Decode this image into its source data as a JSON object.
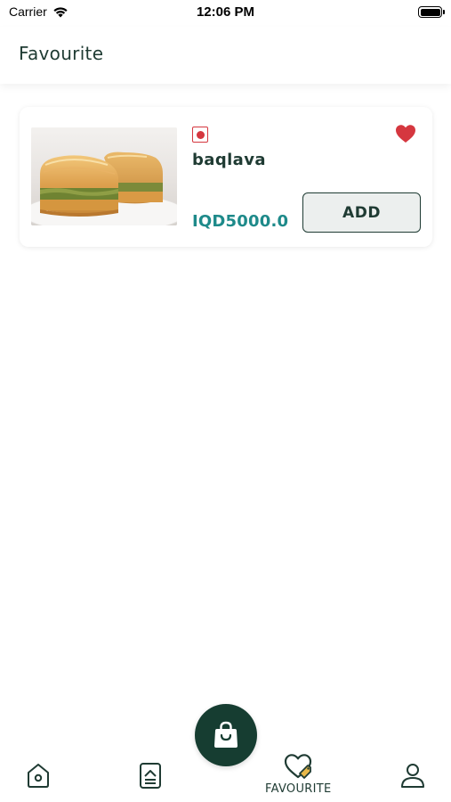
{
  "status_bar": {
    "carrier": "Carrier",
    "time": "12:06 PM"
  },
  "header": {
    "title": "Favourite"
  },
  "favourites": [
    {
      "name": "baqlava",
      "price": "IQD5000.0",
      "add_label": "ADD",
      "favourited": true
    }
  ],
  "bottom_nav": {
    "active": "favourite",
    "items": [
      {
        "id": "home",
        "icon": "home-icon",
        "label": ""
      },
      {
        "id": "orders",
        "icon": "orders-icon",
        "label": ""
      },
      {
        "id": "cart",
        "icon": "shopping-bag-icon",
        "label": ""
      },
      {
        "id": "favourite",
        "icon": "heart-tag-icon",
        "label": "FAVOURITE"
      },
      {
        "id": "profile",
        "icon": "profile-icon",
        "label": ""
      }
    ]
  },
  "colors": {
    "primary": "#163d31",
    "text": "#1f3b33",
    "price": "#1e8a8a",
    "heart": "#d5373f",
    "accent": "#e8b84a"
  }
}
